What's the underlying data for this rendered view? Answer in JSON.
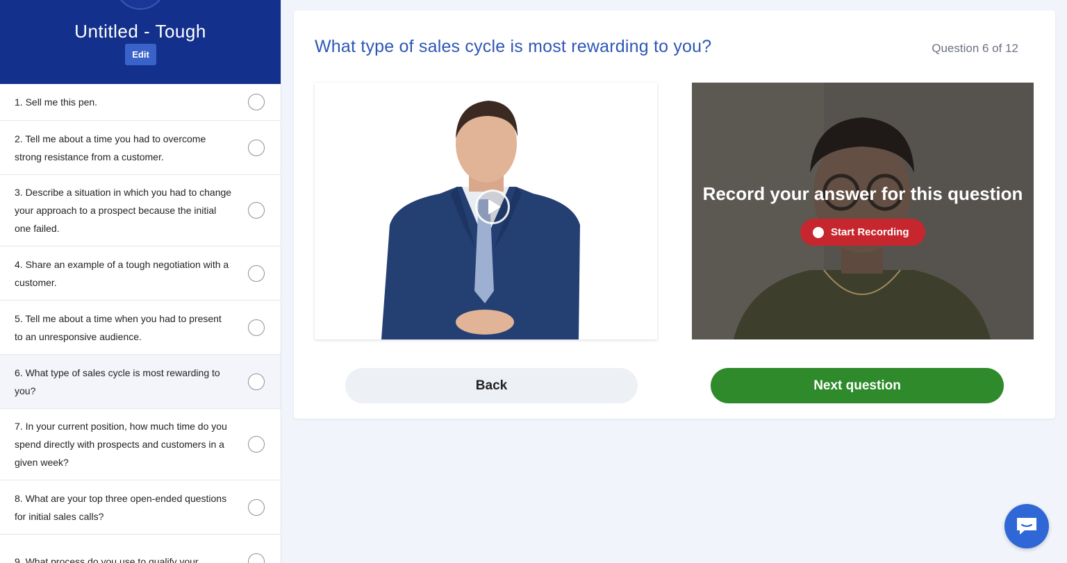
{
  "sidebar": {
    "title": "Untitled - Tough",
    "edit_label": "Edit",
    "questions": [
      {
        "label": "1. Sell me this pen.",
        "active": false
      },
      {
        "label": "2. Tell me about a time you had to overcome strong resistance from a customer.",
        "active": false
      },
      {
        "label": "3. Describe a situation in which you had to change your approach to a prospect because the initial one failed.",
        "active": false
      },
      {
        "label": "4. Share an example of a tough negotiation with a customer.",
        "active": false
      },
      {
        "label": "5. Tell me about a time when you had to present to an unresponsive audience.",
        "active": false
      },
      {
        "label": "6. What type of sales cycle is most rewarding to you?",
        "active": true
      },
      {
        "label": "7. In your current position, how much time do you spend directly with prospects and customers in a given week?",
        "active": false
      },
      {
        "label": "8. What are your top three open-ended questions for initial sales calls?",
        "active": false
      },
      {
        "label": "9. What process do you use to qualify your",
        "active": false
      }
    ]
  },
  "main": {
    "question_title": "What type of sales cycle is most rewarding to you?",
    "question_count": "Question 6 of 12",
    "record_prompt": "Record your answer for this question",
    "start_recording_label": "Start Recording",
    "back_label": "Back",
    "next_label": "Next question"
  },
  "icons": {
    "play": "play-icon",
    "record": "record-dot-icon",
    "chat": "chat-icon"
  },
  "colors": {
    "header_bg": "#13308c",
    "accent_blue": "#2d56b5",
    "record_red": "#c6262e",
    "next_green": "#2e8a2a",
    "chat_blue": "#2f67d6"
  }
}
